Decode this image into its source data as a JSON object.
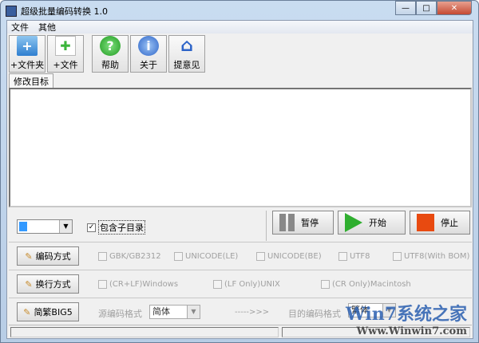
{
  "window": {
    "title": "超级批量编码转换 1.0",
    "minimize": "—",
    "maximize": "□",
    "close": "✕"
  },
  "menu": [
    "文件",
    "其他"
  ],
  "toolbar": [
    {
      "label": "+文件夹",
      "icon": "folder-add-icon"
    },
    {
      "label": "+文件",
      "icon": "file-add-icon"
    },
    {
      "label": "帮助",
      "icon": "help-icon"
    },
    {
      "label": "关于",
      "icon": "info-icon"
    },
    {
      "label": "提意见",
      "icon": "home-icon"
    }
  ],
  "tab": "修改目标",
  "include_subdirs": {
    "label": "包含子目录",
    "checked": true
  },
  "actions": {
    "pause": "暂停",
    "start": "开始",
    "stop": "停止"
  },
  "encoding": {
    "button": "编码方式",
    "options": [
      "GBK/GB2312",
      "UNICODE(LE)",
      "UNICODE(BE)",
      "UTF8",
      "UTF8(With BOM)"
    ]
  },
  "newline": {
    "button": "换行方式",
    "options": [
      "(CR+LF)Windows",
      "(LF Only)UNIX",
      "(CR Only)Macintosh"
    ]
  },
  "big5": {
    "button": "简繁BIG5",
    "source_label": "源编码格式",
    "source_value": "简体",
    "arrow": "----->>>",
    "target_label": "目的编码格式",
    "target_value": "繁体"
  },
  "watermark": {
    "line1": "Win7系统之家",
    "line2": "Www.Winwin7.com"
  }
}
